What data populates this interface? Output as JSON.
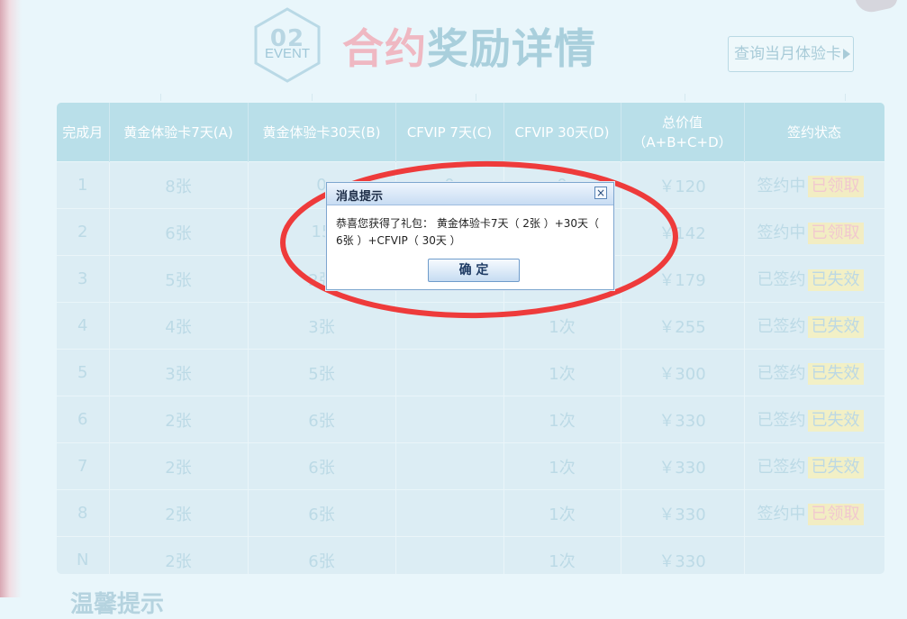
{
  "header": {
    "event_number": "02",
    "event_word": "EVENT",
    "title_part1": "合约",
    "title_part2": "奖励详情",
    "query_button": "查询当月体验卡"
  },
  "table": {
    "columns": [
      {
        "line1": "完成月",
        "line2": ""
      },
      {
        "line1": "黄金体验卡7天(A)",
        "line2": ""
      },
      {
        "line1": "黄金体验卡30天(B)",
        "line2": ""
      },
      {
        "line1": "CFVIP 7天(C)",
        "line2": ""
      },
      {
        "line1": "CFVIP 30天(D)",
        "line2": ""
      },
      {
        "line1": "总价值",
        "line2": "（A+B+C+D）"
      },
      {
        "line1": "签约状态",
        "line2": ""
      }
    ],
    "rows": [
      {
        "month": "1",
        "a": "8张",
        "b": "0",
        "c": "0",
        "d": "0",
        "total": "￥120",
        "status": "签约中",
        "tag": "已领取",
        "tag_type": "got"
      },
      {
        "month": "2",
        "a": "6张",
        "b": "15",
        "c": "",
        "d": "",
        "total": "￥142",
        "status": "签约中",
        "tag": "已领取",
        "tag_type": "got"
      },
      {
        "month": "3",
        "a": "5张",
        "b": "2张",
        "c": "",
        "d": "",
        "total": "￥179",
        "status": "已签约",
        "tag": "已失效",
        "tag_type": "lost"
      },
      {
        "month": "4",
        "a": "4张",
        "b": "3张",
        "c": "",
        "d": "1次",
        "total": "￥255",
        "status": "已签约",
        "tag": "已失效",
        "tag_type": "lost"
      },
      {
        "month": "5",
        "a": "3张",
        "b": "5张",
        "c": "",
        "d": "1次",
        "total": "￥300",
        "status": "已签约",
        "tag": "已失效",
        "tag_type": "lost"
      },
      {
        "month": "6",
        "a": "2张",
        "b": "6张",
        "c": "",
        "d": "1次",
        "total": "￥330",
        "status": "已签约",
        "tag": "已失效",
        "tag_type": "lost"
      },
      {
        "month": "7",
        "a": "2张",
        "b": "6张",
        "c": "",
        "d": "1次",
        "total": "￥330",
        "status": "已签约",
        "tag": "已失效",
        "tag_type": "lost"
      },
      {
        "month": "8",
        "a": "2张",
        "b": "6张",
        "c": "",
        "d": "1次",
        "total": "￥330",
        "status": "签约中",
        "tag": "已领取",
        "tag_type": "got"
      },
      {
        "month": "N",
        "a": "2张",
        "b": "6张",
        "c": "",
        "d": "1次",
        "total": "￥330",
        "status": "",
        "tag": "",
        "tag_type": ""
      }
    ]
  },
  "dialog": {
    "title": "消息提示",
    "close": "×",
    "message": "恭喜您获得了礼包： 黄金体验卡7天（ 2张 ）+30天（ 6张 ）+CFVIP（ 30天 ）",
    "ok_button": "确 定"
  },
  "bottom_heading": "温馨提示",
  "colors": {
    "highlight_ellipse": "#ee3b3b",
    "title_pink": "#efb8c2",
    "title_blue": "#a9cfdc",
    "header_bg": "#b9dfe9"
  }
}
